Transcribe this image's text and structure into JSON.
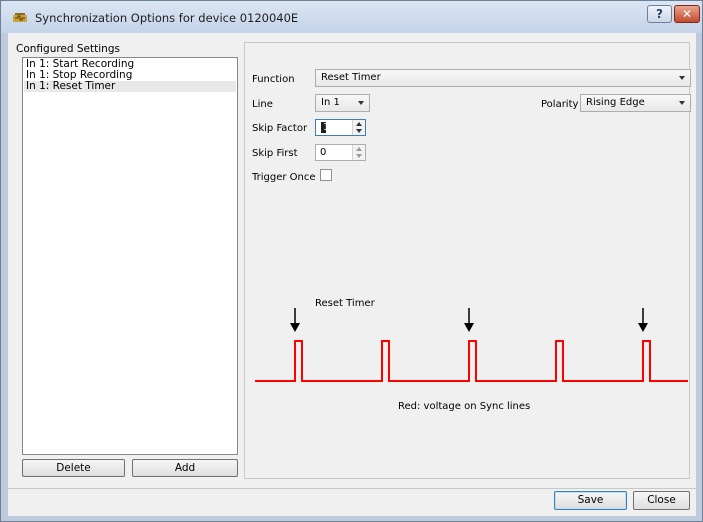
{
  "window": {
    "title": "Synchronization Options for device 0120040E",
    "help_label": "?",
    "close_label": "✕"
  },
  "configured": {
    "label": "Configured Settings",
    "items": [
      {
        "label": "In 1: Start Recording",
        "selected": false
      },
      {
        "label": "In 1: Stop Recording",
        "selected": false
      },
      {
        "label": "In 1: Reset Timer",
        "selected": true
      }
    ],
    "delete_label": "Delete",
    "add_label": "Add"
  },
  "form": {
    "function_label": "Function",
    "function_value": "Reset Timer",
    "line_label": "Line",
    "line_value": "In 1",
    "polarity_label": "Polarity",
    "polarity_value": "Rising Edge",
    "skip_factor_label": "Skip Factor",
    "skip_factor_value": "1",
    "skip_first_label": "Skip First",
    "skip_first_value": "0",
    "trigger_once_label": "Trigger Once",
    "trigger_once_checked": false
  },
  "diagram": {
    "annotation": "Reset Timer",
    "caption": "Red: voltage on Sync lines",
    "signal_color": "#ff0000",
    "pulse_count": 5,
    "marked_pulses": [
      1,
      3,
      5
    ]
  },
  "footer": {
    "save_label": "Save",
    "close_label": "Close"
  }
}
